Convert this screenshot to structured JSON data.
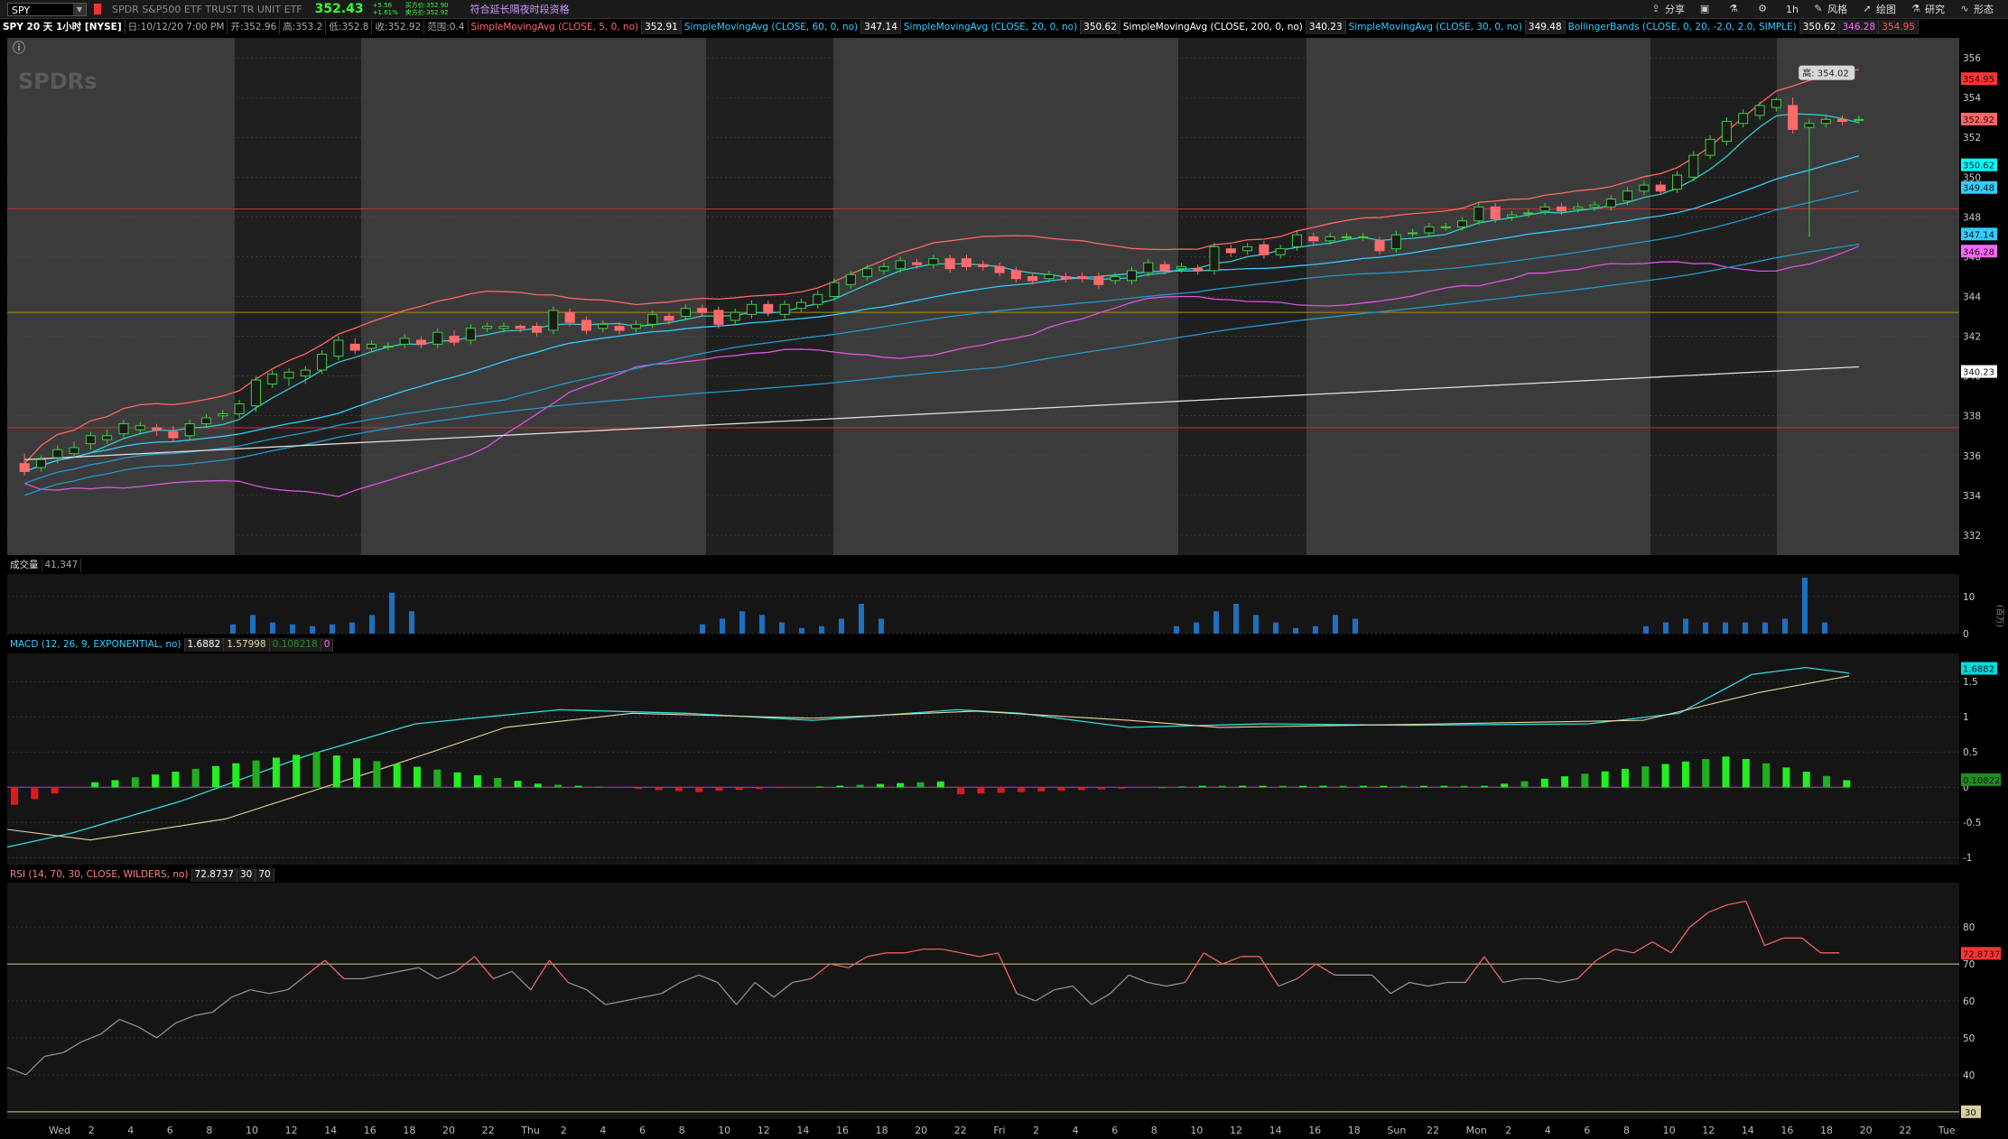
{
  "toolbar": {
    "symbol": "SPY",
    "name": "SPDR S&P500 ETF TRUST TR UNIT ETF",
    "last": "352.43",
    "change": "+5.58",
    "change_pct": "+1.61%",
    "bid": "买方价:352.90",
    "ask": "卖方价:352.92",
    "ext_hours": "符合延长隔夜时段资格",
    "tools": [
      "分享",
      "风格",
      "绘图",
      "研究",
      "形态"
    ],
    "timeframe": "1h"
  },
  "infobar": {
    "title": "SPY 20 天 1小时 [NYSE]",
    "date": "日:10/12/20 7:00 PM",
    "open": "开:352.96",
    "high": "高:353.2",
    "low": "低:352.8",
    "close": "收:352.92",
    "range": "范围:0.4",
    "studies": [
      {
        "label": "SimpleMovingAvg (CLOSE, 5, 0, no)",
        "value": "352.91",
        "color": "#ff6666"
      },
      {
        "label": "SimpleMovingAvg (CLOSE, 60, 0, no)",
        "value": "347.14",
        "color": "#33ccff"
      },
      {
        "label": "SimpleMovingAvg (CLOSE, 20, 0, no)",
        "value": "350.62",
        "color": "#33ccff"
      },
      {
        "label": "SimpleMovingAvg (CLOSE, 200, 0, no)",
        "value": "340.23",
        "color": "#ffffff"
      },
      {
        "label": "SimpleMovingAvg (CLOSE, 30, 0, no)",
        "value": "349.48",
        "color": "#33ccff"
      },
      {
        "label": "BollingerBands (CLOSE, 0, 20, -2.0, 2.0, SIMPLE)",
        "value": "350.62",
        "color": "#33ccff"
      }
    ],
    "bb_lower": "346.28",
    "bb_upper": "354.95"
  },
  "volume_label": {
    "name": "成交量",
    "value": "41,347"
  },
  "macd_label": {
    "name": "MACD (12, 26, 9, EXPONENTIAL, no)",
    "value": "1.6882",
    "avg": "1.57998",
    "diff": "0.108218",
    "zero": "0"
  },
  "rsi_label": {
    "name": "RSI (14, 70, 30, CLOSE, WILDERS, no)",
    "value": "72.8737",
    "os": "30",
    "ob": "70"
  },
  "high_marker": "高: 354.02",
  "volume_unit": "(百万)",
  "chart_data": {
    "type": "candlestick",
    "price_axis": {
      "min": 331,
      "max": 357,
      "ticks": [
        332,
        334,
        336,
        338,
        340,
        342,
        344,
        346,
        348,
        350,
        352,
        354,
        356
      ]
    },
    "price_tags": [
      {
        "label": "354.95",
        "value": 354.95,
        "color": "#ff3333",
        "text": "#111"
      },
      {
        "label": "352.92",
        "value": 352.92,
        "color": "#ff6666",
        "text": "#111"
      },
      {
        "label": "350.62",
        "value": 350.62,
        "color": "#00ffff",
        "text": "#111"
      },
      {
        "label": "349.48",
        "value": 349.48,
        "color": "#33ccff",
        "text": "#111"
      },
      {
        "label": "347.14",
        "value": 347.14,
        "color": "#33ccff",
        "text": "#111"
      },
      {
        "label": "346.28",
        "value": 346.28,
        "color": "#ff66ff",
        "text": "#111"
      },
      {
        "label": "340.23",
        "value": 340.23,
        "color": "#ffffff",
        "text": "#111"
      }
    ],
    "hlines": [
      {
        "value": 348.4,
        "color": "#c23030"
      },
      {
        "value": 343.2,
        "color": "#b09000"
      },
      {
        "value": 337.4,
        "color": "#c23030"
      }
    ],
    "x_labels": [
      "Wed",
      "2",
      "4",
      "6",
      "8",
      "10",
      "12",
      "14",
      "16",
      "18",
      "20",
      "22",
      "Thu",
      "2",
      "4",
      "6",
      "8",
      "10",
      "12",
      "14",
      "16",
      "18",
      "20",
      "22",
      "Fri",
      "2",
      "4",
      "6",
      "8",
      "10",
      "12",
      "14",
      "16",
      "18",
      "Sun",
      "22",
      "Mon",
      "2",
      "4",
      "6",
      "8",
      "10",
      "12",
      "14",
      "16",
      "18",
      "20",
      "22",
      "Tue"
    ],
    "candles": [
      {
        "o": 335.6,
        "c": 335.2,
        "h": 336.1,
        "l": 335.0
      },
      {
        "o": 335.4,
        "c": 335.8,
        "h": 336.0,
        "l": 335.2
      },
      {
        "o": 335.9,
        "c": 336.3,
        "h": 336.5,
        "l": 335.6
      },
      {
        "o": 336.1,
        "c": 336.4,
        "h": 336.7,
        "l": 335.9
      },
      {
        "o": 336.6,
        "c": 337.0,
        "h": 337.2,
        "l": 336.3
      },
      {
        "o": 336.8,
        "c": 337.0,
        "h": 337.3,
        "l": 336.6
      },
      {
        "o": 337.1,
        "c": 337.6,
        "h": 337.8,
        "l": 336.9
      },
      {
        "o": 337.3,
        "c": 337.5,
        "h": 337.7,
        "l": 337.1
      },
      {
        "o": 337.4,
        "c": 337.3,
        "h": 337.6,
        "l": 337.0
      },
      {
        "o": 337.2,
        "c": 336.9,
        "h": 337.5,
        "l": 336.7
      },
      {
        "o": 337.0,
        "c": 337.6,
        "h": 337.8,
        "l": 336.8
      },
      {
        "o": 337.6,
        "c": 337.9,
        "h": 338.1,
        "l": 337.4
      },
      {
        "o": 338.0,
        "c": 338.1,
        "h": 338.3,
        "l": 337.8
      },
      {
        "o": 338.1,
        "c": 338.6,
        "h": 338.8,
        "l": 337.9
      },
      {
        "o": 338.5,
        "c": 339.8,
        "h": 340.0,
        "l": 338.2
      },
      {
        "o": 339.6,
        "c": 340.1,
        "h": 340.3,
        "l": 339.4
      },
      {
        "o": 339.9,
        "c": 340.2,
        "h": 340.4,
        "l": 339.5
      },
      {
        "o": 340.0,
        "c": 340.3,
        "h": 340.5,
        "l": 339.6
      },
      {
        "o": 340.3,
        "c": 341.1,
        "h": 341.3,
        "l": 340.1
      },
      {
        "o": 341.0,
        "c": 341.8,
        "h": 342.0,
        "l": 340.8
      },
      {
        "o": 341.6,
        "c": 341.3,
        "h": 341.9,
        "l": 341.1
      },
      {
        "o": 341.4,
        "c": 341.6,
        "h": 341.8,
        "l": 341.2
      },
      {
        "o": 341.5,
        "c": 341.5,
        "h": 341.7,
        "l": 341.3
      },
      {
        "o": 341.6,
        "c": 341.9,
        "h": 342.1,
        "l": 341.4
      },
      {
        "o": 341.8,
        "c": 341.6,
        "h": 342.0,
        "l": 341.4
      },
      {
        "o": 341.6,
        "c": 342.2,
        "h": 342.4,
        "l": 341.4
      },
      {
        "o": 342.0,
        "c": 341.7,
        "h": 342.3,
        "l": 341.5
      },
      {
        "o": 341.8,
        "c": 342.4,
        "h": 342.6,
        "l": 341.6
      },
      {
        "o": 342.4,
        "c": 342.5,
        "h": 342.7,
        "l": 342.2
      },
      {
        "o": 342.4,
        "c": 342.5,
        "h": 342.7,
        "l": 342.2
      },
      {
        "o": 342.5,
        "c": 342.4,
        "h": 342.6,
        "l": 342.2
      },
      {
        "o": 342.5,
        "c": 342.2,
        "h": 342.7,
        "l": 342.0
      },
      {
        "o": 342.3,
        "c": 343.3,
        "h": 343.5,
        "l": 342.1
      },
      {
        "o": 343.2,
        "c": 342.7,
        "h": 343.4,
        "l": 342.5
      },
      {
        "o": 342.8,
        "c": 342.3,
        "h": 343.0,
        "l": 342.1
      },
      {
        "o": 342.4,
        "c": 342.6,
        "h": 342.8,
        "l": 342.2
      },
      {
        "o": 342.5,
        "c": 342.3,
        "h": 342.7,
        "l": 342.1
      },
      {
        "o": 342.4,
        "c": 342.6,
        "h": 342.8,
        "l": 342.2
      },
      {
        "o": 342.6,
        "c": 343.1,
        "h": 343.3,
        "l": 342.4
      },
      {
        "o": 343.0,
        "c": 342.8,
        "h": 343.2,
        "l": 342.6
      },
      {
        "o": 343.0,
        "c": 343.4,
        "h": 343.6,
        "l": 342.8
      },
      {
        "o": 343.4,
        "c": 343.2,
        "h": 343.6,
        "l": 343.0
      },
      {
        "o": 343.3,
        "c": 342.6,
        "h": 343.5,
        "l": 342.4
      },
      {
        "o": 342.8,
        "c": 343.2,
        "h": 343.4,
        "l": 342.6
      },
      {
        "o": 343.1,
        "c": 343.6,
        "h": 343.8,
        "l": 342.9
      },
      {
        "o": 343.6,
        "c": 343.2,
        "h": 343.8,
        "l": 343.0
      },
      {
        "o": 343.1,
        "c": 343.6,
        "h": 343.8,
        "l": 342.9
      },
      {
        "o": 343.4,
        "c": 343.7,
        "h": 343.9,
        "l": 343.2
      },
      {
        "o": 343.6,
        "c": 344.1,
        "h": 344.3,
        "l": 343.4
      },
      {
        "o": 344.0,
        "c": 344.7,
        "h": 344.9,
        "l": 343.8
      },
      {
        "o": 344.6,
        "c": 345.1,
        "h": 345.3,
        "l": 344.4
      },
      {
        "o": 345.0,
        "c": 345.4,
        "h": 345.6,
        "l": 344.8
      },
      {
        "o": 345.3,
        "c": 345.5,
        "h": 345.7,
        "l": 345.1
      },
      {
        "o": 345.4,
        "c": 345.8,
        "h": 346.0,
        "l": 345.2
      },
      {
        "o": 345.7,
        "c": 345.6,
        "h": 345.9,
        "l": 345.4
      },
      {
        "o": 345.6,
        "c": 345.9,
        "h": 346.1,
        "l": 345.4
      },
      {
        "o": 345.9,
        "c": 345.4,
        "h": 346.1,
        "l": 345.2
      },
      {
        "o": 345.9,
        "c": 345.5,
        "h": 346.1,
        "l": 345.3
      },
      {
        "o": 345.6,
        "c": 345.5,
        "h": 345.8,
        "l": 345.3
      },
      {
        "o": 345.5,
        "c": 345.2,
        "h": 345.7,
        "l": 345.0
      },
      {
        "o": 345.3,
        "c": 344.9,
        "h": 345.5,
        "l": 344.7
      },
      {
        "o": 345.0,
        "c": 344.8,
        "h": 345.2,
        "l": 344.6
      },
      {
        "o": 344.9,
        "c": 345.1,
        "h": 345.3,
        "l": 344.7
      },
      {
        "o": 345.0,
        "c": 344.9,
        "h": 345.2,
        "l": 344.7
      },
      {
        "o": 345.0,
        "c": 344.9,
        "h": 345.2,
        "l": 344.7
      },
      {
        "o": 345.0,
        "c": 344.6,
        "h": 345.2,
        "l": 344.4
      },
      {
        "o": 344.8,
        "c": 345.0,
        "h": 345.2,
        "l": 344.6
      },
      {
        "o": 344.8,
        "c": 345.3,
        "h": 345.5,
        "l": 344.6
      },
      {
        "o": 345.2,
        "c": 345.7,
        "h": 345.9,
        "l": 345.0
      },
      {
        "o": 345.6,
        "c": 345.3,
        "h": 345.8,
        "l": 345.1
      },
      {
        "o": 345.4,
        "c": 345.5,
        "h": 345.7,
        "l": 345.2
      },
      {
        "o": 345.4,
        "c": 345.3,
        "h": 345.6,
        "l": 345.1
      },
      {
        "o": 345.3,
        "c": 346.5,
        "h": 346.7,
        "l": 345.1
      },
      {
        "o": 346.4,
        "c": 346.2,
        "h": 346.6,
        "l": 346.0
      },
      {
        "o": 346.3,
        "c": 346.5,
        "h": 346.7,
        "l": 346.1
      },
      {
        "o": 346.6,
        "c": 346.1,
        "h": 346.8,
        "l": 345.9
      },
      {
        "o": 346.1,
        "c": 346.4,
        "h": 346.6,
        "l": 345.9
      },
      {
        "o": 346.5,
        "c": 347.1,
        "h": 347.3,
        "l": 346.3
      },
      {
        "o": 347.0,
        "c": 346.8,
        "h": 347.2,
        "l": 346.6
      },
      {
        "o": 346.8,
        "c": 347.0,
        "h": 347.2,
        "l": 346.6
      },
      {
        "o": 347.0,
        "c": 347.0,
        "h": 347.2,
        "l": 346.8
      },
      {
        "o": 347.0,
        "c": 347.0,
        "h": 347.2,
        "l": 346.8
      },
      {
        "o": 346.8,
        "c": 346.3,
        "h": 347.0,
        "l": 346.1
      },
      {
        "o": 346.4,
        "c": 347.1,
        "h": 347.3,
        "l": 346.2
      },
      {
        "o": 347.2,
        "c": 347.2,
        "h": 347.4,
        "l": 347.0
      },
      {
        "o": 347.2,
        "c": 347.5,
        "h": 347.7,
        "l": 347.0
      },
      {
        "o": 347.5,
        "c": 347.5,
        "h": 347.7,
        "l": 347.3
      },
      {
        "o": 347.5,
        "c": 347.8,
        "h": 348.0,
        "l": 347.3
      },
      {
        "o": 347.8,
        "c": 348.5,
        "h": 348.7,
        "l": 347.6
      },
      {
        "o": 348.5,
        "c": 347.9,
        "h": 348.7,
        "l": 347.7
      },
      {
        "o": 348.0,
        "c": 348.1,
        "h": 348.3,
        "l": 347.8
      },
      {
        "o": 348.2,
        "c": 348.2,
        "h": 348.4,
        "l": 348.0
      },
      {
        "o": 348.3,
        "c": 348.5,
        "h": 348.7,
        "l": 348.1
      },
      {
        "o": 348.5,
        "c": 348.3,
        "h": 348.7,
        "l": 348.1
      },
      {
        "o": 348.4,
        "c": 348.5,
        "h": 348.7,
        "l": 348.2
      },
      {
        "o": 348.5,
        "c": 348.6,
        "h": 348.8,
        "l": 348.3
      },
      {
        "o": 348.5,
        "c": 348.9,
        "h": 349.1,
        "l": 348.3
      },
      {
        "o": 348.8,
        "c": 349.3,
        "h": 349.5,
        "l": 348.6
      },
      {
        "o": 349.3,
        "c": 349.6,
        "h": 349.8,
        "l": 349.1
      },
      {
        "o": 349.6,
        "c": 349.3,
        "h": 349.8,
        "l": 349.1
      },
      {
        "o": 349.4,
        "c": 350.1,
        "h": 350.3,
        "l": 349.2
      },
      {
        "o": 350.0,
        "c": 351.1,
        "h": 351.3,
        "l": 349.8
      },
      {
        "o": 351.1,
        "c": 351.9,
        "h": 352.1,
        "l": 350.9
      },
      {
        "o": 351.8,
        "c": 352.8,
        "h": 353.0,
        "l": 351.6
      },
      {
        "o": 352.7,
        "c": 353.2,
        "h": 353.4,
        "l": 352.5
      },
      {
        "o": 353.1,
        "c": 353.6,
        "h": 353.8,
        "l": 352.9
      },
      {
        "o": 353.5,
        "c": 353.9,
        "h": 354.0,
        "l": 353.3
      },
      {
        "o": 353.6,
        "c": 352.4,
        "h": 354.0,
        "l": 352.2
      },
      {
        "o": 352.5,
        "c": 352.7,
        "h": 352.9,
        "l": 347.0
      },
      {
        "o": 352.7,
        "c": 352.9,
        "h": 353.1,
        "l": 352.5
      },
      {
        "o": 352.9,
        "c": 352.8,
        "h": 353.1,
        "l": 352.6
      },
      {
        "o": 352.9,
        "c": 352.9,
        "h": 353.1,
        "l": 352.7
      }
    ],
    "volume": [
      0,
      0,
      0,
      0,
      0,
      0,
      0,
      0,
      0,
      0,
      0,
      0,
      0,
      0,
      2.5,
      5,
      3,
      2.5,
      2,
      2.5,
      3,
      5,
      11,
      6,
      0,
      0,
      0,
      0,
      0,
      0,
      0,
      0,
      0,
      0,
      0,
      0,
      0,
      0,
      0,
      0,
      0,
      0,
      0,
      0,
      0,
      0,
      0,
      0,
      0,
      0,
      0,
      0,
      0,
      0,
      0,
      0,
      0,
      0,
      0,
      0,
      0,
      0,
      0,
      0,
      0,
      0,
      0,
      0,
      0,
      0,
      0,
      0,
      0,
      0,
      0,
      0,
      0,
      0,
      0,
      0,
      0,
      0,
      0,
      0,
      0,
      0,
      0,
      0,
      0,
      0,
      0,
      0,
      0,
      0,
      0,
      0,
      0,
      0,
      0,
      0,
      0,
      0,
      0,
      0,
      0,
      0,
      0,
      0,
      0,
      0
    ],
    "volume_axis": {
      "max": 16,
      "ticks": [
        0,
        10
      ]
    },
    "macd": {
      "axis": {
        "min": -1.1,
        "max": 1.9,
        "ticks": [
          -1,
          -0.5,
          0,
          0.5,
          1,
          1.5
        ]
      },
      "value_tag": "1.6882",
      "diff_tag": "0.10822"
    },
    "rsi": {
      "axis": {
        "min": 28,
        "max": 92,
        "ticks": [
          30,
          40,
          50,
          60,
          70,
          80
        ]
      },
      "levels": [
        70,
        30
      ],
      "value_tag": "72.8737"
    }
  }
}
